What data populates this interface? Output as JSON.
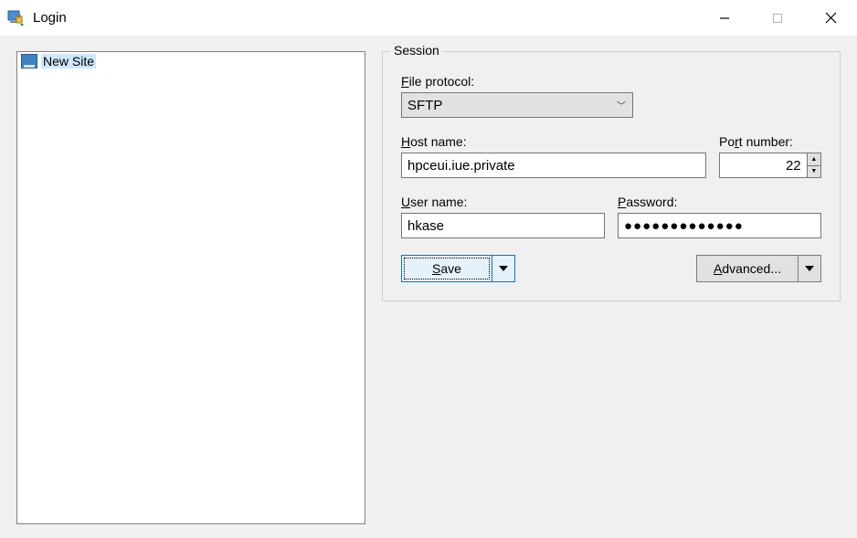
{
  "window": {
    "title": "Login"
  },
  "sites": {
    "items": [
      {
        "label": "New Site",
        "selected": true
      }
    ]
  },
  "session": {
    "groupLabel": "Session",
    "protocol": {
      "label_pre": "F",
      "label_rest": "ile protocol:",
      "value": "SFTP"
    },
    "host": {
      "label_pre": "H",
      "label_rest": "ost name:",
      "value": "hpceui.iue.private"
    },
    "port": {
      "label_pre": "Po",
      "label_u": "r",
      "label_rest": "t number:",
      "value": "22"
    },
    "user": {
      "label_pre": "U",
      "label_rest": "ser name:",
      "value": "hkase"
    },
    "password": {
      "label_pre": "P",
      "label_rest": "assword:",
      "value": "●●●●●●●●●●●●●"
    },
    "buttons": {
      "save_pre": "S",
      "save_rest": "ave",
      "advanced_pre": "A",
      "advanced_rest": "dvanced..."
    }
  }
}
